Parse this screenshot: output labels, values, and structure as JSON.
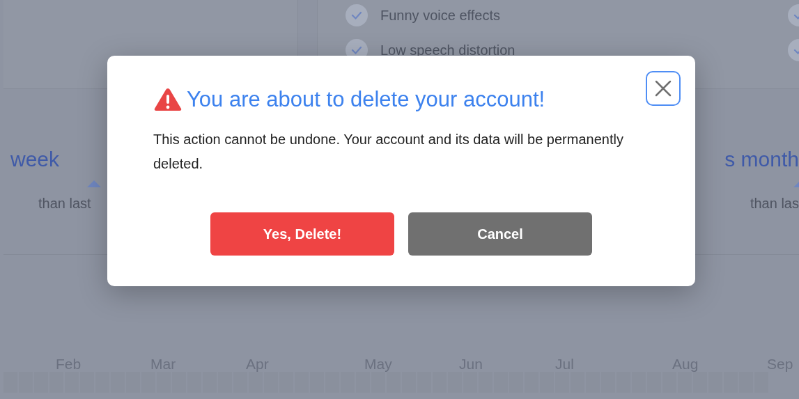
{
  "background": {
    "features": [
      {
        "label": "Funny voice effects",
        "checked": true
      },
      {
        "label": "Low speech distortion",
        "checked": true
      }
    ],
    "stats": [
      {
        "heading": "week",
        "note": "than last"
      },
      {
        "heading": "s month",
        "note": "than las"
      }
    ],
    "months": [
      "Feb",
      "Mar",
      "Apr",
      "May",
      "Jun",
      "Jul",
      "Aug",
      "Sep"
    ]
  },
  "dialog": {
    "title": "You are about to delete your account!",
    "message": "This action cannot be undone. Your account and its data will be permanently deleted.",
    "buttons": [
      {
        "label": "Yes, Delete!",
        "kind": "danger"
      },
      {
        "label": "Cancel",
        "kind": "neutral"
      }
    ]
  }
}
